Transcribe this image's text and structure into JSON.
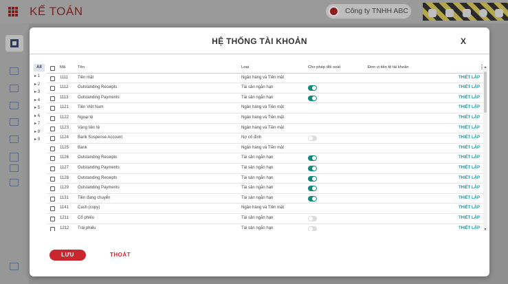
{
  "app": {
    "title": "KẾ TOÁN",
    "company": "Công ty TNHH ABC"
  },
  "modal": {
    "title": "HỆ THỐNG TÀI KHOẢN",
    "close_label": "X",
    "save_label": "LƯU",
    "exit_label": "THOÁT"
  },
  "levels": {
    "all_label": "All",
    "items": [
      "1",
      "2",
      "3",
      "4",
      "5",
      "6",
      "7",
      "8",
      "9"
    ]
  },
  "table": {
    "columns": {
      "code": "Mã",
      "name": "Tên",
      "type": "Loại",
      "reconcile": "Cho phép đối soát",
      "currency": "Đơn vị tiền tệ tài khoản",
      "menu": "⋮"
    },
    "setup_label": "THIẾT LẬP",
    "rows": [
      {
        "code": "1111",
        "name": "Tiền mặt",
        "type": "Ngân hàng và Tiền mặt",
        "reconcile": null
      },
      {
        "code": "1112",
        "name": "Outstanding Receipts",
        "type": "Tài sản ngắn hạn",
        "reconcile": true
      },
      {
        "code": "1113",
        "name": "Outstanding Payments",
        "type": "Tài sản ngắn hạn",
        "reconcile": true
      },
      {
        "code": "1121",
        "name": "Tiền Việt Nam",
        "type": "Ngân hàng và Tiền mặt",
        "reconcile": null
      },
      {
        "code": "1122",
        "name": "Ngoại tệ",
        "type": "Ngân hàng và Tiền mặt",
        "reconcile": null
      },
      {
        "code": "1123",
        "name": "Vàng tiền tệ",
        "type": "Ngân hàng và Tiền mặt",
        "reconcile": null
      },
      {
        "code": "1124",
        "name": "Bank Suspense Account",
        "type": "Nợ cố định",
        "reconcile": false
      },
      {
        "code": "1125",
        "name": "Bank",
        "type": "Ngân hàng và Tiền mặt",
        "reconcile": null
      },
      {
        "code": "1126",
        "name": "Outstanding Receipts",
        "type": "Tài sản ngắn hạn",
        "reconcile": true
      },
      {
        "code": "1127",
        "name": "Outstanding Payments",
        "type": "Tài sản ngắn hạn",
        "reconcile": true
      },
      {
        "code": "1128",
        "name": "Outstanding Receipts",
        "type": "Tài sản ngắn hạn",
        "reconcile": true
      },
      {
        "code": "1129",
        "name": "Outstanding Payments",
        "type": "Tài sản ngắn hạn",
        "reconcile": true
      },
      {
        "code": "1131",
        "name": "Tiền đang chuyển",
        "type": "Tài sản ngắn hạn",
        "reconcile": true
      },
      {
        "code": "1141",
        "name": "Cash (copy)",
        "type": "Ngân hàng và Tiền mặt",
        "reconcile": null
      },
      {
        "code": "1211",
        "name": "Cổ phiếu",
        "type": "Tài sản ngắn hạn",
        "reconcile": false
      },
      {
        "code": "1212",
        "name": "Trái phiếu",
        "type": "Tài sản ngắn hạn",
        "reconcile": false
      }
    ]
  },
  "colors": {
    "brand": "#c8282d",
    "toggle_on": "#0f8a7b",
    "link": "#179aa3"
  }
}
